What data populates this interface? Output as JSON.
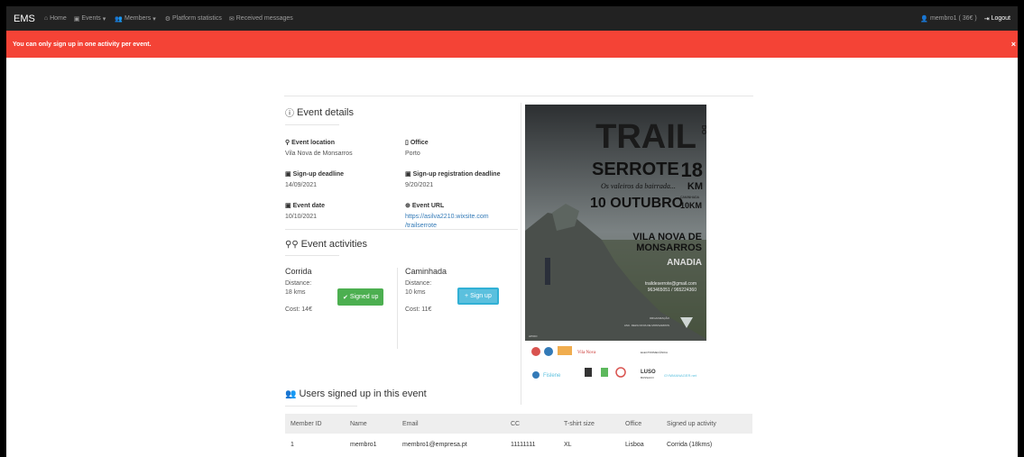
{
  "navbar": {
    "brand": "EMS",
    "items": [
      {
        "label": "Home",
        "icon": "home-icon"
      },
      {
        "label": "Events",
        "icon": "calendar-icon",
        "caret": true
      },
      {
        "label": "Members",
        "icon": "users-icon",
        "caret": true
      },
      {
        "label": "Platform statistics",
        "icon": "gear-icon"
      },
      {
        "label": "Received messages",
        "icon": "envelope-icon"
      }
    ],
    "user": "membro1 ( 36€ )",
    "logout": "Logout"
  },
  "alert": {
    "message": "You can only sign up in one activity per event.",
    "close": "×"
  },
  "event_details": {
    "heading": "Event details",
    "location_label": "Event location",
    "location_value": "Vila Nova de Monsarros",
    "office_label": "Office",
    "office_value": "Porto",
    "signup_deadline_label": "Sign-up deadline",
    "signup_deadline_value": "14/09/2021",
    "reg_deadline_label": "Sign-up registration deadline",
    "reg_deadline_value": "9/20/2021",
    "date_label": "Event date",
    "date_value": "10/10/2021",
    "url_label": "Event URL",
    "url_value_line1": "https://asilva2210.wixsite.com",
    "url_value_line2": "/trailserrote"
  },
  "activities": {
    "heading": "Event activities",
    "items": [
      {
        "name": "Corrida",
        "distance_label": "Distance:",
        "distance": "18 kms",
        "cost": "Cost: 14€",
        "button": "Signed up"
      },
      {
        "name": "Caminhada",
        "distance_label": "Distance:",
        "distance": "10 kms",
        "cost": "Cost: 11€",
        "button": "Sign up"
      }
    ]
  },
  "poster": {
    "title": "TRAIL",
    "do": "DO",
    "serrote": "SERROTE",
    "km_num": "18",
    "km": "KM",
    "tagline": "Os valeiros da bairrada...",
    "date": "10 OUTUBRO",
    "caminhada": "CAMINHADA",
    "km10": "10KM",
    "place1": "VILA NOVA DE",
    "place2": "MONSARROS",
    "place3": "ANADIA",
    "email": "traildeserrote@gmail.com",
    "phones": "963465051 / 965224360",
    "org": "ORGANIZAÇÃO",
    "org2": "ASC. DEZA NOVA DE MONSARROS",
    "apoio": "APOIO",
    "sponsors": [
      "Vila Nova",
      "ELECTROMECÂNICA",
      "Fislene",
      "LUSO",
      "BUSSACO",
      "GYMMANAGER.net"
    ]
  },
  "users": {
    "heading": "Users signed up in this event",
    "columns": [
      "Member ID",
      "Name",
      "Email",
      "CC",
      "T-shirt size",
      "Office",
      "Signed up activity"
    ],
    "rows": [
      [
        "1",
        "membro1",
        "membro1@empresa.pt",
        "11111111",
        "XL",
        "Lisboa",
        "Corrida (18kms)"
      ]
    ]
  }
}
